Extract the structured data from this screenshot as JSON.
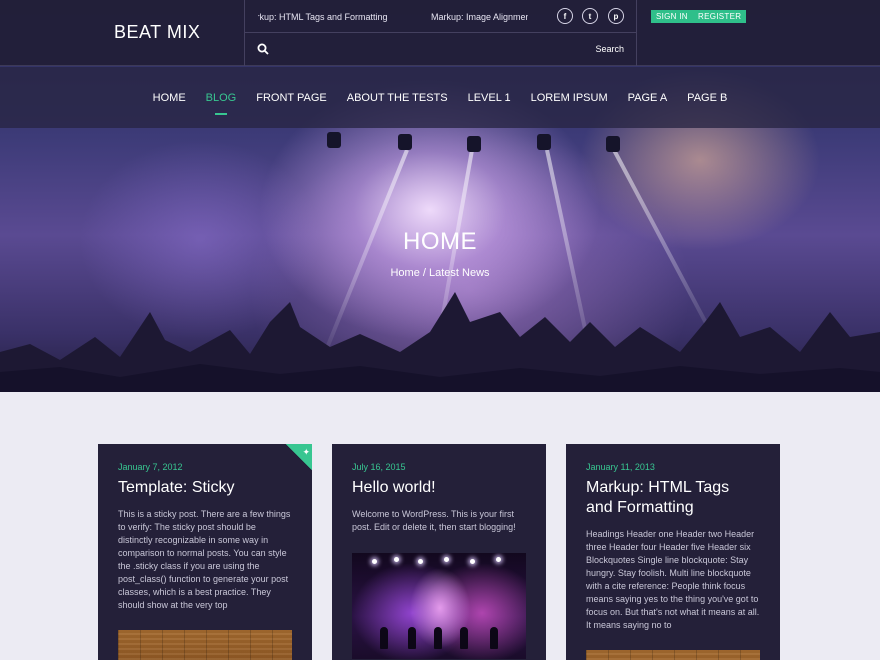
{
  "site": {
    "brand": "BEAT MIX"
  },
  "ticker": [
    {
      "text": "Markup: HTML Tags and Formatting"
    },
    {
      "text": "Markup: Image Alignment"
    }
  ],
  "social": [
    {
      "name": "facebook",
      "glyph": "f"
    },
    {
      "name": "twitter",
      "glyph": "t"
    },
    {
      "name": "pinterest",
      "glyph": "p"
    }
  ],
  "auth": {
    "sign_in": "SIGN IN",
    "register": "REGISTER"
  },
  "search": {
    "placeholder": "Search"
  },
  "nav": {
    "items": [
      {
        "label": "HOME",
        "active": false
      },
      {
        "label": "BLOG",
        "active": true
      },
      {
        "label": "FRONT PAGE",
        "active": false
      },
      {
        "label": "ABOUT THE TESTS",
        "active": false
      },
      {
        "label": "LEVEL 1",
        "active": false
      },
      {
        "label": "LOREM IPSUM",
        "active": false
      },
      {
        "label": "PAGE A",
        "active": false
      },
      {
        "label": "PAGE B",
        "active": false
      }
    ]
  },
  "hero": {
    "title": "HOME",
    "breadcrumb": "Home / Latest News"
  },
  "posts": [
    {
      "date": "January 7, 2012",
      "title": "Template: Sticky",
      "excerpt": "This is a sticky post. There are a few things to verify: The sticky post should be distinctly recognizable in some way in comparison to normal posts. You can style the .sticky class if you are using the post_class() function to generate your post classes, which is a best practice. They should show at the very top",
      "sticky": true
    },
    {
      "date": "July 16, 2015",
      "title": "Hello world!",
      "excerpt": "Welcome to WordPress. This is your first post. Edit or delete it, then start blogging!",
      "sticky": false
    },
    {
      "date": "January 11, 2013",
      "title": "Markup: HTML Tags and Formatting",
      "excerpt": "Headings Header one Header two Header three Header four Header five Header six Blockquotes Single line blockquote: Stay hungry. Stay foolish. Multi line blockquote with a cite reference: People think focus means saying yes to the thing you've got to focus on. But that's not what it means at all. It means saying no to",
      "sticky": false
    }
  ],
  "colors": {
    "accent": "#38c691",
    "header_bg": "#221f38",
    "card_bg": "#242039",
    "page_bg": "#ecebf3"
  }
}
